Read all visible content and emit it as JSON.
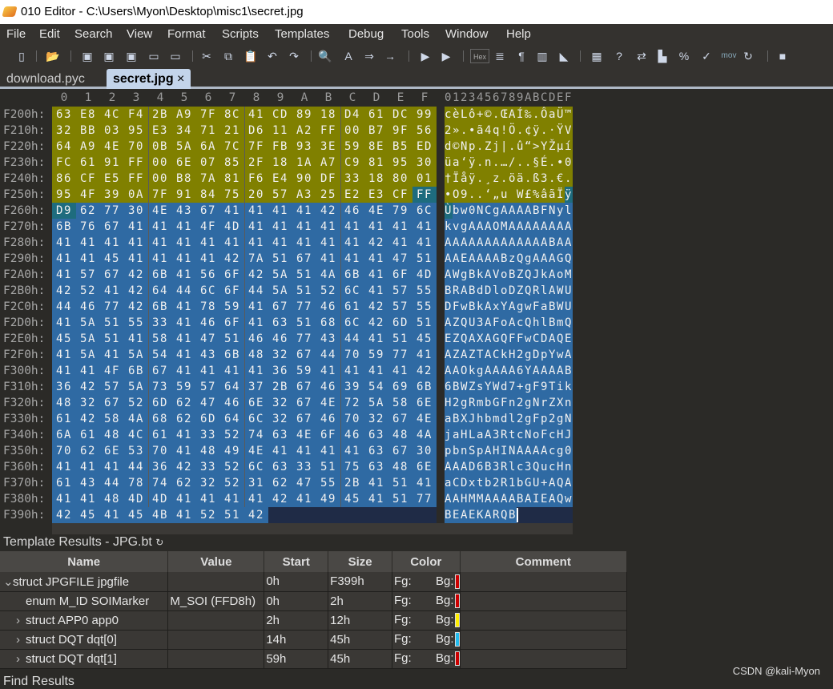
{
  "window": {
    "title": "010 Editor - C:\\Users\\Myon\\Desktop\\misc1\\secret.jpg"
  },
  "menu": [
    "File",
    "Edit",
    "Search",
    "View",
    "Format",
    "Scripts",
    "Templates",
    "Debug",
    "Tools",
    "Window",
    "Help"
  ],
  "toolbar": {
    "icons": [
      "new-file",
      "open-file",
      "save",
      "save-as",
      "save-all",
      "open-folder",
      "open-workspace",
      "cut",
      "copy",
      "paste",
      "undo",
      "redo",
      "find",
      "replace",
      "find-in-files",
      "goto",
      "run-script",
      "run-template",
      "hex",
      "text-format",
      "paragraph",
      "columns",
      "highlight",
      "calculator",
      "inspector",
      "compare",
      "histogram",
      "percent",
      "checksum",
      "mov",
      "base-converter",
      "stop"
    ],
    "hex_label": "Hex",
    "mov_label": "mov"
  },
  "tabs": [
    {
      "label": "download.pyc",
      "active": false
    },
    {
      "label": "secret.jpg",
      "active": true,
      "close": "×"
    }
  ],
  "hex": {
    "column_headers": [
      "0",
      "1",
      "2",
      "3",
      "4",
      "5",
      "6",
      "7",
      "8",
      "9",
      "A",
      "B",
      "C",
      "D",
      "E",
      "F"
    ],
    "ascii_header": "0123456789ABCDEF",
    "rows": [
      {
        "addr": "F200h:",
        "bytes": "63 E8 4C F4 2B A9 7F 8C 41 CD 89 18 D4 61 DC 99",
        "ascii": "cèLô+©.ŒAÍ‰.ÔaÜ™"
      },
      {
        "addr": "F210h:",
        "bytes": "32 BB 03 95 E3 34 71 21 D6 11 A2 FF 00 B7 9F 56",
        "ascii": "2».•ã4q!Ö.¢ÿ.·ŸV"
      },
      {
        "addr": "F220h:",
        "bytes": "64 A9 4E 70 0B 5A 6A 7C 7F FB 93 3E 59 8E B5 ED",
        "ascii": "d©Np.Zj|.û“>YŽµí"
      },
      {
        "addr": "F230h:",
        "bytes": "FC 61 91 FF 00 6E 07 85 2F 18 1A A7 C9 81 95 30",
        "ascii": "üa‘ÿ.n.…/..§É.•0"
      },
      {
        "addr": "F240h:",
        "bytes": "86 CF E5 FF 00 B8 7A 81 F6 E4 90 DF 33 18 80 01",
        "ascii": "†Ïåÿ.¸z.öä.ß3.€."
      },
      {
        "addr": "F250h:",
        "bytes": "95 4F 39 0A 7F 91 84 75 20 57 A3 25 E2 E3 CF FF",
        "ascii": "•O9..‘„u W£%âãÏÿ"
      },
      {
        "addr": "F260h:",
        "bytes": "D9 62 77 30 4E 43 67 41 41 41 41 42 46 4E 79 6C",
        "ascii": "Ùbw0NCgAAAABFNyl"
      },
      {
        "addr": "F270h:",
        "bytes": "6B 76 67 41 41 41 4F 4D 41 41 41 41 41 41 41 41",
        "ascii": "kvgAAAOMAAAAAAAA"
      },
      {
        "addr": "F280h:",
        "bytes": "41 41 41 41 41 41 41 41 41 41 41 41 41 42 41 41",
        "ascii": "AAAAAAAAAAAAABAA"
      },
      {
        "addr": "F290h:",
        "bytes": "41 41 45 41 41 41 41 42 7A 51 67 41 41 41 47 51",
        "ascii": "AAEAAAABzQgAAAGQ"
      },
      {
        "addr": "F2A0h:",
        "bytes": "41 57 67 42 6B 41 56 6F 42 5A 51 4A 6B 41 6F 4D",
        "ascii": "AWgBkAVoBZQJkAoM"
      },
      {
        "addr": "F2B0h:",
        "bytes": "42 52 41 42 64 44 6C 6F 44 5A 51 52 6C 41 57 55",
        "ascii": "BRABdDloDZQRlAWU"
      },
      {
        "addr": "F2C0h:",
        "bytes": "44 46 77 42 6B 41 78 59 41 67 77 46 61 42 57 55",
        "ascii": "DFwBkAxYAgwFaBWU"
      },
      {
        "addr": "F2D0h:",
        "bytes": "41 5A 51 55 33 41 46 6F 41 63 51 68 6C 42 6D 51",
        "ascii": "AZQU3AFoAcQhlBmQ"
      },
      {
        "addr": "F2E0h:",
        "bytes": "45 5A 51 41 58 41 47 51 46 46 77 43 44 41 51 45",
        "ascii": "EZQAXAGQFFwCDAQE"
      },
      {
        "addr": "F2F0h:",
        "bytes": "41 5A 41 5A 54 41 43 6B 48 32 67 44 70 59 77 41",
        "ascii": "AZAZTACkH2gDpYwA"
      },
      {
        "addr": "F300h:",
        "bytes": "41 41 4F 6B 67 41 41 41 41 36 59 41 41 41 41 42",
        "ascii": "AAOkgAAAA6YAAAAB"
      },
      {
        "addr": "F310h:",
        "bytes": "36 42 57 5A 73 59 57 64 37 2B 67 46 39 54 69 6B",
        "ascii": "6BWZsYWd7+gF9Tik"
      },
      {
        "addr": "F320h:",
        "bytes": "48 32 67 52 6D 62 47 46 6E 32 67 4E 72 5A 58 6E",
        "ascii": "H2gRmbGFn2gNrZXn"
      },
      {
        "addr": "F330h:",
        "bytes": "61 42 58 4A 68 62 6D 64 6C 32 67 46 70 32 67 4E",
        "ascii": "aBXJhbmdl2gFp2gN"
      },
      {
        "addr": "F340h:",
        "bytes": "6A 61 48 4C 61 41 33 52 74 63 4E 6F 46 63 48 4A",
        "ascii": "jaHLaA3RtcNoFcHJ"
      },
      {
        "addr": "F350h:",
        "bytes": "70 62 6E 53 70 41 48 49 4E 41 41 41 41 63 67 30",
        "ascii": "pbnSpAHINAAAAcg0"
      },
      {
        "addr": "F360h:",
        "bytes": "41 41 41 44 36 42 33 52 6C 63 33 51 75 63 48 6E",
        "ascii": "AAAD6B3Rlc3QucHn"
      },
      {
        "addr": "F370h:",
        "bytes": "61 43 44 78 74 62 32 52 31 62 47 55 2B 41 51 41",
        "ascii": "aCDxtb2R1bGU+AQA"
      },
      {
        "addr": "F380h:",
        "bytes": "41 41 48 4D 4D 41 41 41 41 42 41 49 45 41 51 77",
        "ascii": "AAHMMAAAABAIEAQw"
      },
      {
        "addr": "F390h:",
        "bytes": "42 45 41 45 4B 41 52 51 42",
        "ascii": "BEAEKARQB"
      }
    ]
  },
  "colors": {
    "template_app_data": "#808000",
    "template_tail": "#2f6aa3",
    "selection_marker": "#1e6c7e",
    "past_end": "#1f2b46"
  },
  "template_results": {
    "title": "Template Results - JPG.bt",
    "refresh_icon": "refresh-icon",
    "columns": [
      "Name",
      "Value",
      "Start",
      "Size",
      "Color",
      "Comment"
    ],
    "rows": [
      {
        "expander": "⌄",
        "name": "struct JPGFILE jpgfile",
        "value": "",
        "start": "0h",
        "size": "F399h",
        "fg": "Fg:",
        "bg": "Bg:",
        "bg_color": "#cc0000",
        "comment": "",
        "indent": 0
      },
      {
        "expander": "",
        "name": "enum M_ID SOIMarker",
        "value": "M_SOI (FFD8h)",
        "start": "0h",
        "size": "2h",
        "fg": "Fg:",
        "bg": "Bg:",
        "bg_color": "#cc0000",
        "comment": "",
        "indent": 1
      },
      {
        "expander": "›",
        "name": "struct APP0 app0",
        "value": "",
        "start": "2h",
        "size": "12h",
        "fg": "Fg:",
        "bg": "Bg:",
        "bg_color": "#ffee00",
        "comment": "",
        "indent": 1
      },
      {
        "expander": "›",
        "name": "struct DQT dqt[0]",
        "value": "",
        "start": "14h",
        "size": "45h",
        "fg": "Fg:",
        "bg": "Bg:",
        "bg_color": "#22bbee",
        "comment": "",
        "indent": 1
      },
      {
        "expander": "›",
        "name": "struct DQT dqt[1]",
        "value": "",
        "start": "59h",
        "size": "45h",
        "fg": "Fg:",
        "bg": "Bg:",
        "bg_color": "#cc0000",
        "comment": "",
        "indent": 1
      }
    ]
  },
  "find_results": {
    "title": "Find Results"
  },
  "watermark": "CSDN @kali-Myon"
}
